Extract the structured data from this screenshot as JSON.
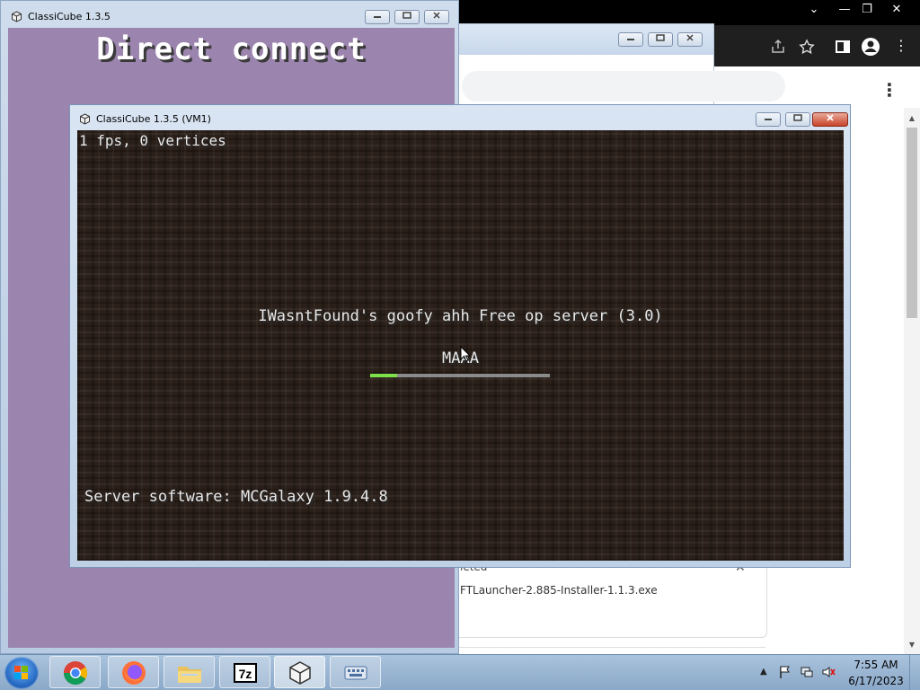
{
  "browser": {
    "window_controls": [
      "—",
      "❐",
      "✕"
    ],
    "toolbar_icons": [
      "share-icon",
      "star-icon",
      "sidepanel-icon",
      "profile-icon",
      "menu-icon"
    ],
    "menu_dots": "⋮",
    "chevron": "⌄",
    "downloads": {
      "heading": "leted",
      "file": "FTLauncher-2.885-Installer-1.1.3.exe",
      "close": "✕"
    }
  },
  "launcher": {
    "title": "ClassiCube 1.3.5",
    "heading": "Direct connect",
    "controls": [
      "—",
      "❐",
      "✕"
    ]
  },
  "game": {
    "title": "ClassiCube 1.3.5 (VM1)",
    "controls": [
      "—",
      "❐",
      "✕"
    ],
    "fps_text": "1 fps, 0 vertices",
    "server_name": "IWasntFound's goofy ahh Free op server (3.0)",
    "server_motd": "MAAA",
    "loading_progress": 0.15,
    "server_software": "Server software: MCGalaxy 1.9.4.8",
    "colors": {
      "progress_fill": "#7de04a",
      "progress_track": "#8a8a8a",
      "dirt_bg": "#2a1f19"
    }
  },
  "taskbar": {
    "apps": [
      {
        "name": "chrome-icon"
      },
      {
        "name": "firefox-icon"
      },
      {
        "name": "file-explorer-icon"
      },
      {
        "name": "7zip-icon",
        "label": "7z"
      },
      {
        "name": "classicube-icon"
      },
      {
        "name": "keyboard-icon"
      }
    ],
    "clock_time": "7:55 AM",
    "clock_date": "6/17/2023"
  }
}
